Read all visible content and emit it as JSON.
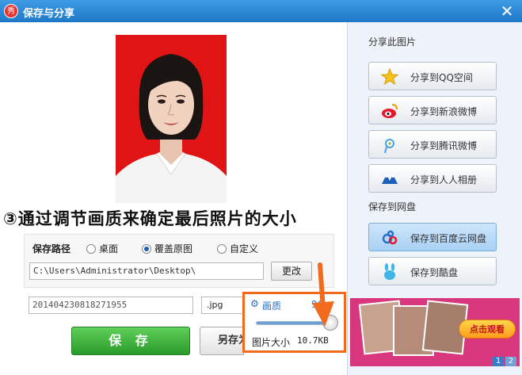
{
  "window": {
    "title": "保存与分享",
    "logo_text": "秀",
    "close_glyph": "✕"
  },
  "annotation": "③通过调节画质来确定最后照片的大小",
  "save_path": {
    "label": "保存路径",
    "options": [
      {
        "label": "桌面",
        "selected": false
      },
      {
        "label": "覆盖原图",
        "selected": true
      },
      {
        "label": "自定义",
        "selected": false
      }
    ],
    "path_value": "C:\\Users\\Administrator\\Desktop\\",
    "change_label": "更改"
  },
  "file": {
    "name_value": "20140423081827195​5",
    "extension": ".jpg"
  },
  "quality": {
    "label": "画质",
    "value": "96",
    "slider_fraction": 0.96,
    "size_label": "图片大小",
    "size_value": "10.7KB"
  },
  "buttons": {
    "save": "保 存",
    "save_as": "另存为"
  },
  "share": {
    "title": "分享此图片",
    "items": [
      {
        "label": "分享到QQ空间",
        "icon": "qzone-star-icon"
      },
      {
        "label": "分享到新浪微博",
        "icon": "sina-weibo-icon"
      },
      {
        "label": "分享到腾讯微博",
        "icon": "tencent-weibo-icon"
      },
      {
        "label": "分享到人人相册",
        "icon": "renren-icon"
      }
    ]
  },
  "netdisk": {
    "title": "保存到网盘",
    "items": [
      {
        "label": "保存到百度云网盘",
        "icon": "baidu-cloud-icon",
        "selected": true
      },
      {
        "label": "保存到酷盘",
        "icon": "kupan-bunny-icon",
        "selected": false
      }
    ]
  },
  "ad": {
    "button_label": "点击观看",
    "pages": [
      "1",
      "2"
    ]
  },
  "colors": {
    "titlebar": "#1e78c8",
    "photo_background": "#e01414",
    "highlight_border": "#f26b1d",
    "save_button": "#2a9a2a",
    "quality_text": "#2a6fc9"
  }
}
